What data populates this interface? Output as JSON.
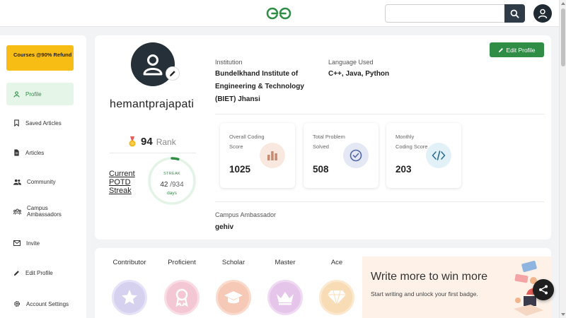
{
  "header": {
    "logo_icon": "geeksforgeeks-logo-icon",
    "search_placeholder": "",
    "search_icon": "search-icon",
    "user_icon": "user-avatar-icon"
  },
  "sidebar": {
    "promo_label": "Courses @90% Refund",
    "items": [
      {
        "label": "Profile",
        "icon": "user-icon",
        "active": true
      },
      {
        "label": "Saved Articles",
        "icon": "bookmark-icon",
        "active": false
      },
      {
        "label": "Articles",
        "icon": "document-icon",
        "active": false
      },
      {
        "label": "Community",
        "icon": "people-icon",
        "active": false
      },
      {
        "label": "Campus Ambassadors",
        "icon": "group-icon",
        "active": false
      },
      {
        "label": "Invite",
        "icon": "mail-icon",
        "active": false
      },
      {
        "label": "Edit Profile",
        "icon": "pencil-icon",
        "active": false
      },
      {
        "label": "Account Settings",
        "icon": "gear-icon",
        "active": false
      }
    ]
  },
  "profile": {
    "username": "hemantprajapati",
    "rank_value": "94",
    "rank_label": "Rank",
    "potd_label": "Current POTD Streak",
    "streak_title": "STREAK",
    "streak_current": "42",
    "streak_total": "/934",
    "streak_unit": "days",
    "streak_fraction": 0.045,
    "edit_button": "Edit Profile",
    "institution_label": "Institution",
    "institution_value": "Bundelkhand Institute of Engineering & Technology (BIET) Jhansi",
    "language_label": "Language Used",
    "language_value": "C++, Java, Python",
    "campus_label": "Campus Ambassador",
    "campus_value": "gehiv",
    "stats": [
      {
        "label": "Overall Coding Score",
        "value": "1025",
        "icon": "bar-chart-icon"
      },
      {
        "label": "Total Problem Solved",
        "value": "508",
        "icon": "check-circle-icon"
      },
      {
        "label": "Monthly Coding Score",
        "value": "203",
        "icon": "code-icon"
      }
    ]
  },
  "badges": {
    "items": [
      {
        "name": "Contributor",
        "icon": "star-badge-icon"
      },
      {
        "name": "Proficient",
        "icon": "ribbon-badge-icon"
      },
      {
        "name": "Scholar",
        "icon": "graduation-cap-badge-icon"
      },
      {
        "name": "Master",
        "icon": "crown-badge-icon"
      },
      {
        "name": "Ace",
        "icon": "diamond-badge-icon"
      }
    ],
    "promo_title": "Write more to win more",
    "promo_subtitle": "Start writing and unlock your first badge."
  },
  "colors": {
    "brand_green": "#2f8d46",
    "promo_yellow": "#f8bd14",
    "dark": "#253038"
  }
}
